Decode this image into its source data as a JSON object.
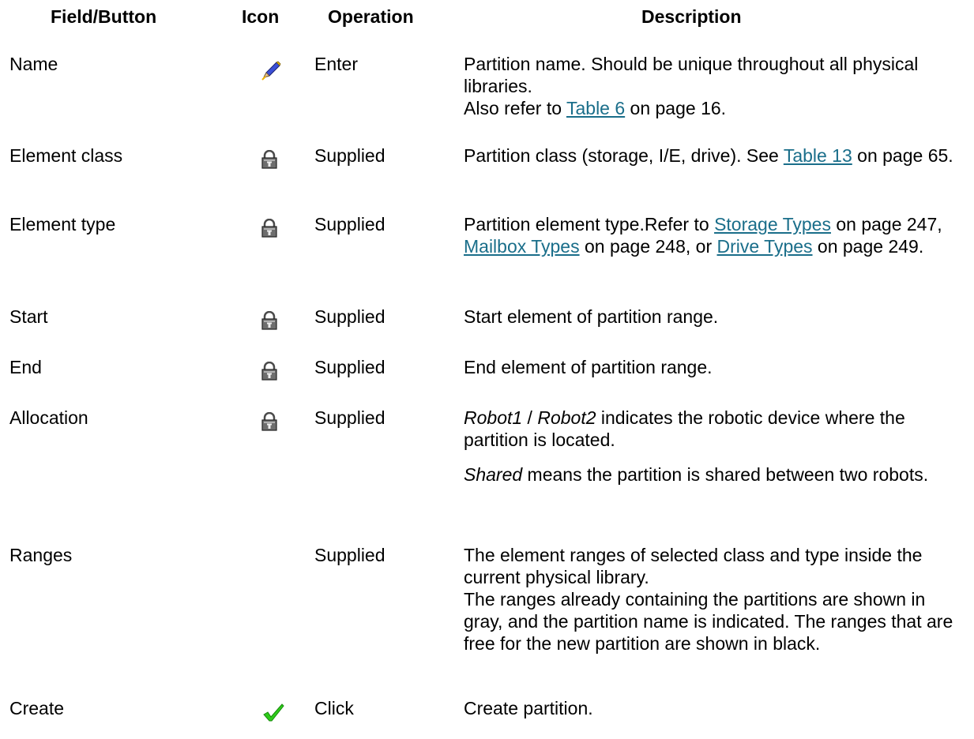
{
  "headers": {
    "field": "Field/Button",
    "icon": "Icon",
    "operation": "Operation",
    "description": "Description"
  },
  "icons": {
    "edit": "pencil-edit-icon",
    "locked": "padlock-icon",
    "confirm": "green-checkmark-icon"
  },
  "rows": [
    {
      "field": "Name",
      "icon": "edit",
      "operation": "Enter",
      "desc": {
        "line1": "Partition name. Should be unique throughout all physical libraries.",
        "line2_pre": "Also refer to ",
        "line2_link": "Table 6",
        "line2_post": " on page 16."
      }
    },
    {
      "field": "Element class",
      "icon": "locked",
      "operation": "Supplied",
      "desc": {
        "pre": "Partition class (storage, I/E, drive). See ",
        "link": "Table 13",
        "post": " on page 65."
      }
    },
    {
      "field": "Element type",
      "icon": "locked",
      "operation": "Supplied",
      "desc": {
        "t1": "Partition element type.Refer to ",
        "l1": "Storage Types",
        "t2": " on page 247, ",
        "l2": "Mailbox Types",
        "t3": " on page 248, or ",
        "l3": "Drive Types",
        "t4": " on page 249."
      }
    },
    {
      "field": "Start",
      "icon": "locked",
      "operation": "Supplied",
      "desc": {
        "text": "Start element of partition range."
      }
    },
    {
      "field": "End",
      "icon": "locked",
      "operation": "Supplied",
      "desc": {
        "text": "End element of partition range."
      }
    },
    {
      "field": "Allocation",
      "icon": "locked",
      "operation": "Supplied",
      "desc": {
        "it1": "Robot1",
        "sep": " / ",
        "it2": "Robot2",
        "rest1": " indicates the robotic device where the partition is located.",
        "it3": "Shared",
        "rest2": " means the partition is shared between two robots."
      }
    },
    {
      "field": "Ranges",
      "icon": "",
      "operation": "Supplied",
      "desc": {
        "line1": "The element ranges of selected class and type inside the current physical library.",
        "line2": "The ranges already containing the partitions are shown in gray, and the partition name is indicated. The ranges that are free for the new partition are shown in black."
      }
    },
    {
      "field": "Create",
      "icon": "confirm",
      "operation": "Click",
      "desc": {
        "text": "Create partition."
      }
    }
  ],
  "colors": {
    "link": "#1a6e8a",
    "check": "#2ecc1a",
    "lock": "#4a4a4a"
  }
}
